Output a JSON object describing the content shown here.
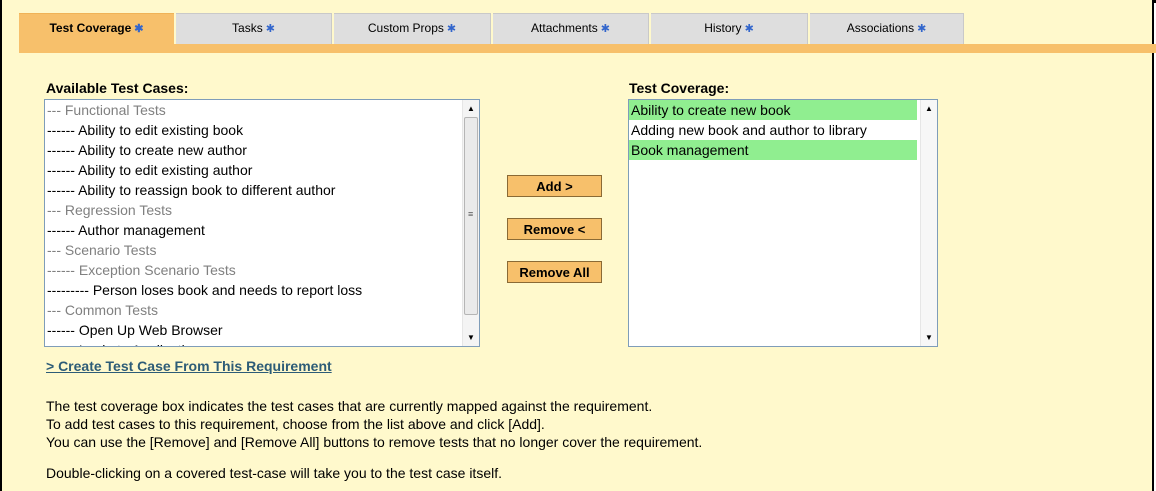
{
  "tabs": [
    {
      "label": "Test Coverage",
      "active": true
    },
    {
      "label": "Tasks",
      "active": false
    },
    {
      "label": "Custom Props",
      "active": false
    },
    {
      "label": "Attachments",
      "active": false
    },
    {
      "label": "History",
      "active": false
    },
    {
      "label": "Associations",
      "active": false
    }
  ],
  "tab_star": "✱",
  "available": {
    "label": "Available Test Cases:",
    "options": [
      {
        "text": "--- Functional Tests",
        "kind": "group"
      },
      {
        "text": "------ Ability to edit existing book",
        "kind": "item"
      },
      {
        "text": "------ Ability to create new author",
        "kind": "item"
      },
      {
        "text": "------ Ability to edit existing author",
        "kind": "item"
      },
      {
        "text": "------ Ability to reassign book to different author",
        "kind": "item"
      },
      {
        "text": "--- Regression Tests",
        "kind": "group"
      },
      {
        "text": "------ Author management",
        "kind": "item"
      },
      {
        "text": "--- Scenario Tests",
        "kind": "group"
      },
      {
        "text": "------ Exception Scenario Tests",
        "kind": "group"
      },
      {
        "text": "--------- Person loses book and needs to report loss",
        "kind": "item"
      },
      {
        "text": "--- Common Tests",
        "kind": "group"
      },
      {
        "text": "------ Open Up Web Browser",
        "kind": "item"
      },
      {
        "text": "------ Login to Application",
        "kind": "item"
      }
    ]
  },
  "buttons": {
    "add": "Add >",
    "remove": "Remove <",
    "remove_all": "Remove All"
  },
  "coverage": {
    "label": "Test Coverage:",
    "options": [
      {
        "text": "Ability to create new book",
        "selected": true
      },
      {
        "text": "Adding new book and author to library",
        "selected": false
      },
      {
        "text": "Book management",
        "selected": true
      }
    ]
  },
  "create_link": "> Create Test Case From This Requirement",
  "help": [
    "The test coverage box indicates the test cases that are currently mapped against the requirement.",
    "To add test cases to this requirement, choose from the list above and click [Add].",
    "You can use the [Remove] and [Remove All] buttons to remove tests that no longer cover the requirement.",
    "Double-clicking on a covered test-case will take you to the test case itself."
  ],
  "colors": {
    "panel_bg": "#fff9cc",
    "tab_active": "#f7c06b",
    "tab_inactive": "#dedede",
    "selected_option": "#90ee90",
    "link": "#2d5c77",
    "star": "#3366cc"
  }
}
